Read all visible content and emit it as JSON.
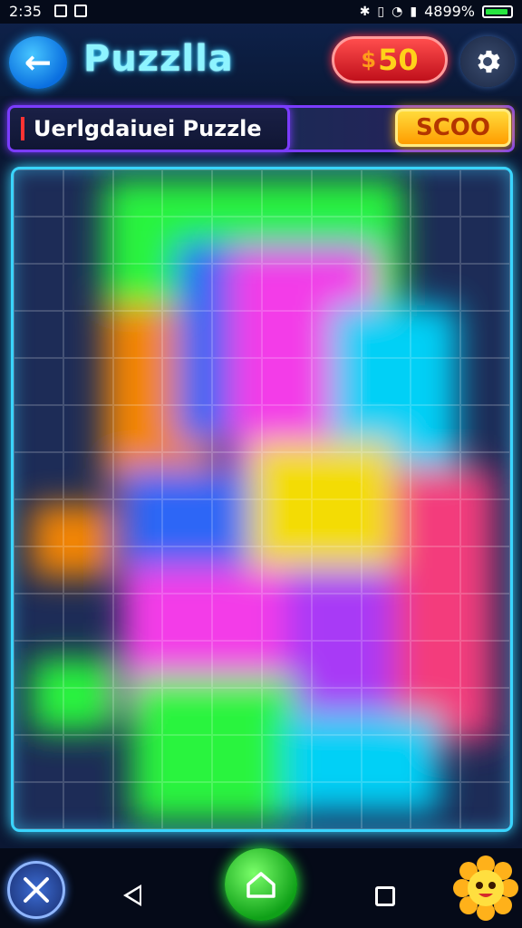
{
  "status_bar": {
    "time": "2:35",
    "battery": "4899%"
  },
  "header": {
    "title": "Puzzlla",
    "coins": "50",
    "coin_symbol": "$"
  },
  "level": {
    "name": "Uerlgdaiuei Puzzle",
    "score": "SCOO"
  },
  "board": {
    "columns": 10,
    "rows": 14,
    "glow_colors": [
      "#ff3d7f",
      "#ff8a00",
      "#ffe600",
      "#2bff3d",
      "#00d9ff",
      "#2f6bff",
      "#b03bff",
      "#ff3df0"
    ]
  },
  "colors": {
    "accent": "#39d5ff",
    "coin_pill": "#e5172a",
    "score_badge": "#ffb000",
    "home_button": "#1ec22a"
  },
  "icons": [
    "arrow-left-icon",
    "gear-icon",
    "tools-icon",
    "back-triangle-icon",
    "home-icon",
    "recent-square-icon",
    "sunflower-mascot-icon"
  ]
}
